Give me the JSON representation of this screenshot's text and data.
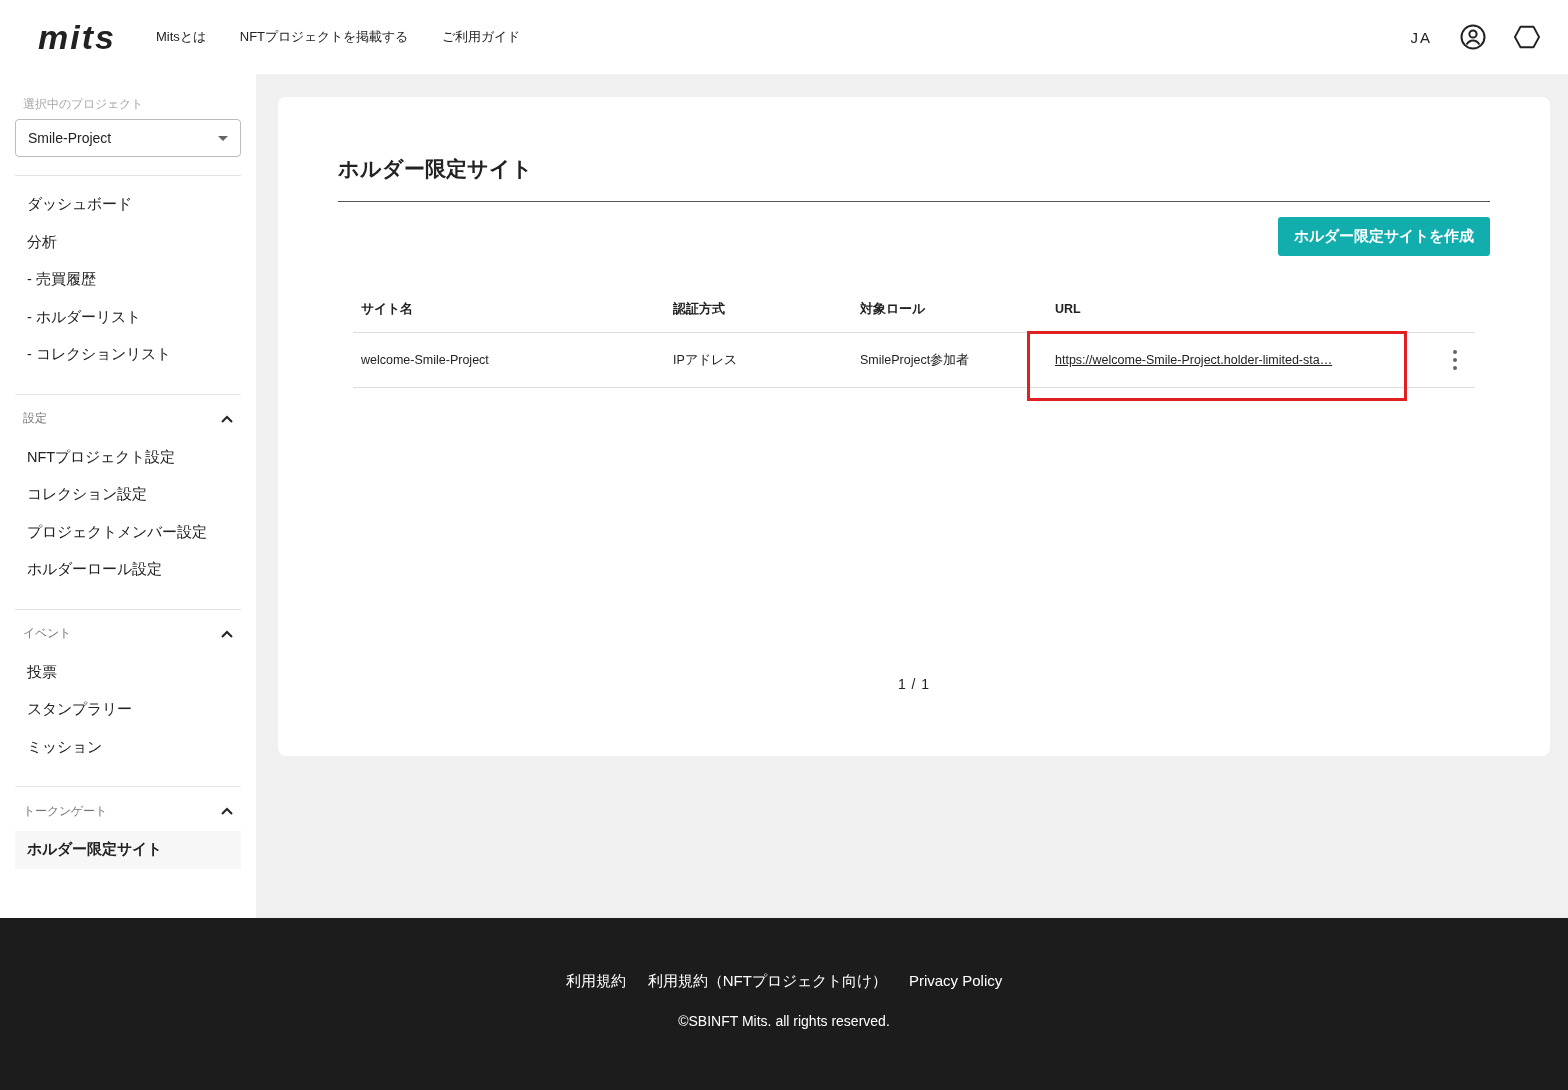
{
  "header": {
    "logo": "mits",
    "nav": [
      "Mitsとは",
      "NFTプロジェクトを掲載する",
      "ご利用ガイド"
    ],
    "language": "JA"
  },
  "sidebar": {
    "project_label": "選択中のプロジェクト",
    "project": "Smile-Project",
    "main_items": [
      {
        "label": "ダッシュボード",
        "selected": false
      },
      {
        "label": "分析",
        "selected": false
      },
      {
        "label": "- 売買履歴",
        "selected": false
      },
      {
        "label": "- ホルダーリスト",
        "selected": false
      },
      {
        "label": "- コレクションリスト",
        "selected": false
      }
    ],
    "sections": [
      {
        "title": "設定",
        "expanded": true,
        "items": [
          {
            "label": "NFTプロジェクト設定",
            "selected": false
          },
          {
            "label": "コレクション設定",
            "selected": false
          },
          {
            "label": "プロジェクトメンバー設定",
            "selected": false
          },
          {
            "label": "ホルダーロール設定",
            "selected": false
          }
        ]
      },
      {
        "title": "イベント",
        "expanded": true,
        "items": [
          {
            "label": "投票",
            "selected": false
          },
          {
            "label": "スタンプラリー",
            "selected": false
          },
          {
            "label": "ミッション",
            "selected": false
          }
        ]
      },
      {
        "title": "トークンゲート",
        "expanded": true,
        "items": [
          {
            "label": "ホルダー限定サイト",
            "selected": true
          }
        ]
      }
    ]
  },
  "page": {
    "title": "ホルダー限定サイト",
    "create_button": "ホルダー限定サイトを作成",
    "table": {
      "columns": [
        "サイト名",
        "認証方式",
        "対象ロール",
        "URL"
      ],
      "rows": [
        {
          "site_name": "welcome-Smile-Project",
          "auth": "IPアドレス",
          "role": "SmileProject参加者",
          "url": "https://welcome-Smile-Project.holder-limited-sta…",
          "url_highlighted": true
        }
      ]
    },
    "pagination": "1 / 1"
  },
  "footer": {
    "links": [
      "利用規約",
      "利用規約（NFTプロジェクト向け）",
      "Privacy Policy"
    ],
    "copyright": "©SBINFT Mits. all rights reserved."
  }
}
